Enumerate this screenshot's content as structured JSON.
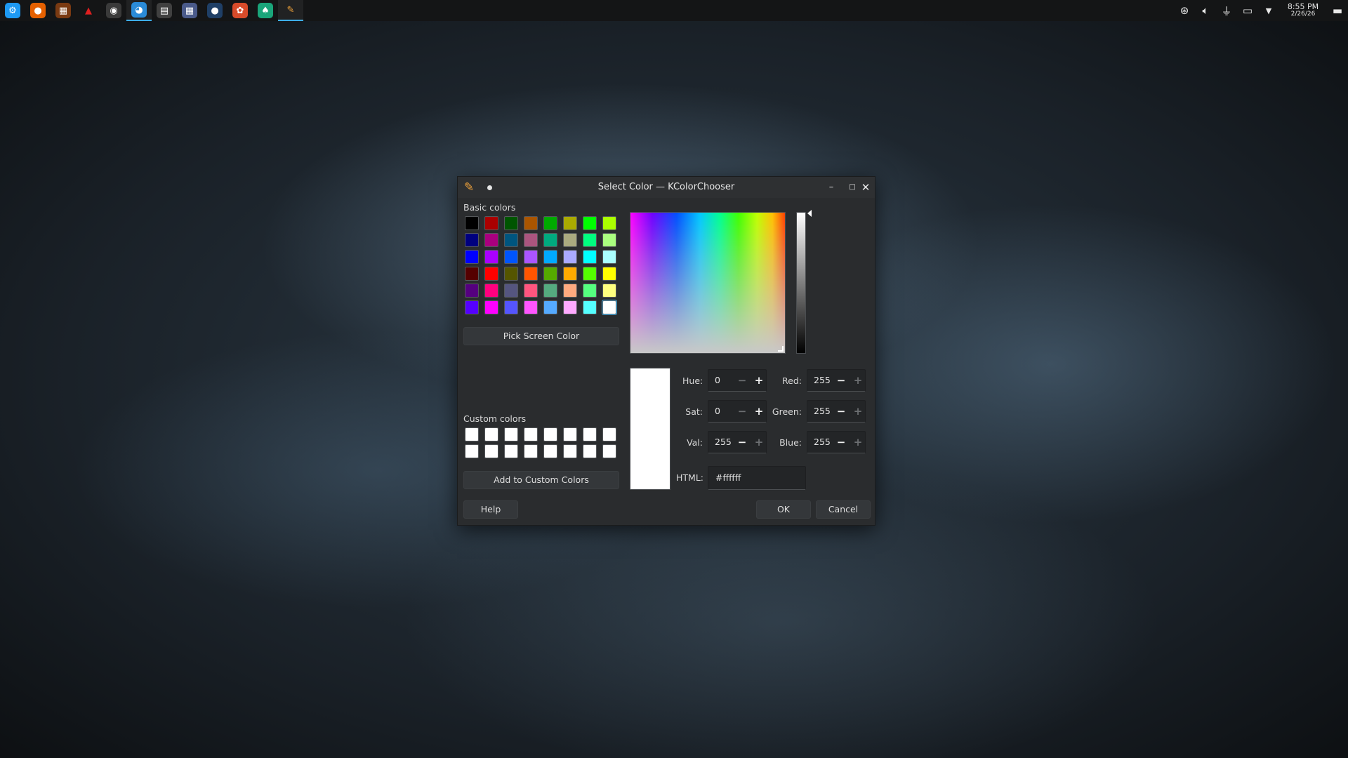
{
  "taskbar": {
    "apps": [
      {
        "name": "kde-app-icon",
        "bg": "#1d99f3",
        "glyph": "⚙"
      },
      {
        "name": "firefox-icon",
        "bg": "#e66000",
        "glyph": "●"
      },
      {
        "name": "app-brown-icon",
        "bg": "#7a3a12",
        "glyph": "▦"
      },
      {
        "name": "triangle-red-icon",
        "bg": "transparent",
        "glyph": "▲",
        "color": "#e02020"
      },
      {
        "name": "obs-icon",
        "bg": "#3a3a3a",
        "glyph": "◉"
      },
      {
        "name": "color-wheel-app-icon",
        "bg": "#2a8bd8",
        "glyph": "◕",
        "active": true
      },
      {
        "name": "terminal-app-icon",
        "bg": "#404040",
        "glyph": "▤"
      },
      {
        "name": "grid-app-icon",
        "bg": "#4a5a8a",
        "glyph": "▦"
      },
      {
        "name": "blue-circle-app-icon",
        "bg": "#1f3f66",
        "glyph": "●"
      },
      {
        "name": "pinwheel-app-icon",
        "bg": "#d84b2a",
        "glyph": "✿"
      },
      {
        "name": "green-app-icon",
        "bg": "#1aa57a",
        "glyph": "♠"
      },
      {
        "name": "color-picker-app-icon",
        "bg": "transparent",
        "glyph": "✎",
        "color": "#f1a33a",
        "active": true
      }
    ],
    "tray": [
      "system-icon",
      "volume-icon",
      "usb-icon",
      "display-icon",
      "chevron-down-icon"
    ],
    "time": "8:55 PM",
    "date": "2/26/26"
  },
  "dialog": {
    "title": "Select Color — KColorChooser",
    "basic_colors_label": "Basic colors",
    "basic_colors": [
      [
        "#000000",
        "#aa0000",
        "#005500",
        "#aa5500",
        "#00aa00",
        "#aaaa00",
        "#00ff00",
        "#aaff00"
      ],
      [
        "#00007f",
        "#aa007f",
        "#00557f",
        "#aa557f",
        "#00aa7f",
        "#aaaa7f",
        "#00ff7f",
        "#aaff7f"
      ],
      [
        "#0000ff",
        "#aa00ff",
        "#0055ff",
        "#aa55ff",
        "#00aaff",
        "#aaaaff",
        "#00ffff",
        "#aaffff"
      ],
      [
        "#550000",
        "#ff0000",
        "#555500",
        "#ff5500",
        "#55aa00",
        "#ffaa00",
        "#55ff00",
        "#ffff00"
      ],
      [
        "#55007f",
        "#ff007f",
        "#55557f",
        "#ff557f",
        "#55aa7f",
        "#ffaa7f",
        "#55ff7f",
        "#ffff7f"
      ],
      [
        "#5500ff",
        "#ff00ff",
        "#5555ff",
        "#ff55ff",
        "#55aaff",
        "#ffaaff",
        "#55ffff",
        "#ffffff"
      ]
    ],
    "pick_screen_color": "Pick Screen Color",
    "custom_colors_label": "Custom colors",
    "custom_colors": [
      [
        "#ffffff",
        "#ffffff",
        "#ffffff",
        "#ffffff",
        "#ffffff",
        "#ffffff",
        "#ffffff",
        "#ffffff"
      ],
      [
        "#ffffff",
        "#ffffff",
        "#ffffff",
        "#ffffff",
        "#ffffff",
        "#ffffff",
        "#ffffff",
        "#ffffff"
      ]
    ],
    "add_to_custom": "Add to Custom Colors",
    "fields": {
      "hue": {
        "label": "Hue:",
        "value": "0"
      },
      "sat": {
        "label": "Sat:",
        "value": "0"
      },
      "val": {
        "label": "Val:",
        "value": "255"
      },
      "red": {
        "label": "Red:",
        "value": "255"
      },
      "green": {
        "label": "Green:",
        "value": "255"
      },
      "blue": {
        "label": "Blue:",
        "value": "255"
      },
      "html": {
        "label": "HTML:",
        "value": "#ffffff"
      }
    },
    "current_color": "#ffffff",
    "help": "Help",
    "ok": "OK",
    "cancel": "Cancel"
  }
}
